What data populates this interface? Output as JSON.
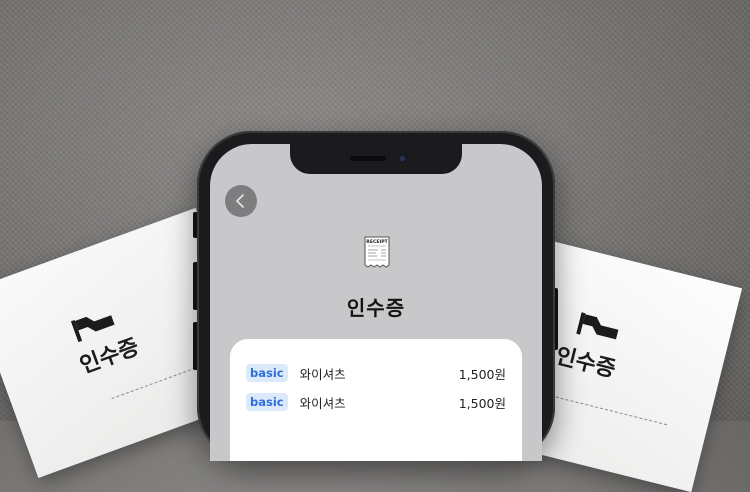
{
  "left_paper": {
    "label": "인수증"
  },
  "right_paper": {
    "label": "인수증"
  },
  "screen": {
    "back_icon": "chevron-left-icon",
    "receipt_icon": {
      "name": "receipt-icon",
      "text": "RECEIPT"
    },
    "title": "인수증",
    "items": [
      {
        "badge": "basic",
        "name": "와이셔츠",
        "price": "1,500원"
      },
      {
        "badge": "basic",
        "name": "와이셔츠",
        "price": "1,500원"
      }
    ]
  },
  "colors": {
    "badge_bg": "#dce9fb",
    "badge_text": "#2f6fd8",
    "screen_bg": "#c8c8cb",
    "phone_frame": "#1b1b1d"
  }
}
